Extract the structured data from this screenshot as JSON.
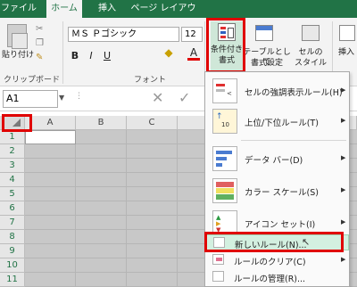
{
  "tabs": [
    "ファイル",
    "ホーム",
    "挿入",
    "ページ レイアウト"
  ],
  "ribbon": {
    "paste_label": "貼り付け",
    "clipboard_label": "クリップボード",
    "font_label": "フォント",
    "font_name": "ＭＳ Ｐゴシック",
    "font_size": "12",
    "bold": "B",
    "italic": "I",
    "underline": "U",
    "conditional_formatting_label_1": "条件付き",
    "conditional_formatting_label_2": "書式",
    "format_as_table_label_1": "テーブルとして",
    "format_as_table_label_2": "書式設定",
    "cell_styles_label_1": "セルの",
    "cell_styles_label_2": "スタイル",
    "insert_label": "挿入"
  },
  "formula_bar": {
    "name_box": "A1",
    "cancel_symbol": "✕",
    "enter_symbol": "✓"
  },
  "sheet": {
    "columns": [
      "A",
      "B",
      "C"
    ],
    "rows": [
      "1",
      "2",
      "3",
      "4",
      "5",
      "6",
      "7",
      "8",
      "9",
      "10",
      "11"
    ]
  },
  "menu": {
    "items": [
      {
        "label": "セルの強調表示ルール(H)",
        "has_submenu": true
      },
      {
        "label": "上位/下位ルール(T)",
        "has_submenu": true
      },
      {
        "label": "データ バー(D)",
        "has_submenu": true
      },
      {
        "label": "カラー スケール(S)",
        "has_submenu": true
      },
      {
        "label": "アイコン セット(I)",
        "has_submenu": true
      },
      {
        "label": "新しいルール(N)...",
        "has_submenu": false
      },
      {
        "label": "ルールのクリア(C)",
        "has_submenu": true
      },
      {
        "label": "ルールの管理(R)...",
        "has_submenu": false
      }
    ],
    "top_ten_icon_text": "10"
  },
  "colors": {
    "excel_green": "#217346",
    "highlight_red": "#e00000",
    "selected_item_bg": "#d3f0e0"
  }
}
